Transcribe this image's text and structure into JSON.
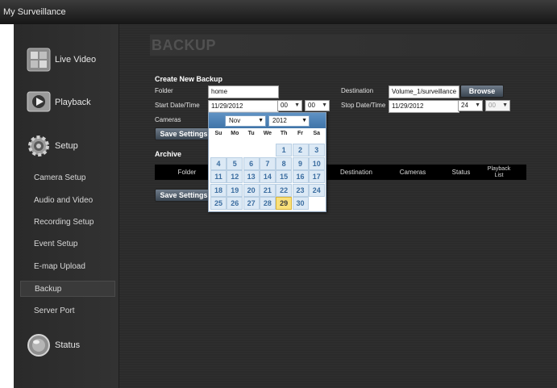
{
  "window": {
    "title": "My Surveillance"
  },
  "sidebar": {
    "main_items": [
      {
        "label": "Live Video",
        "icon": "live-video-icon"
      },
      {
        "label": "Playback",
        "icon": "playback-icon"
      },
      {
        "label": "Setup",
        "icon": "gear-icon"
      },
      {
        "label": "Status",
        "icon": "status-icon"
      }
    ],
    "setup_items": [
      {
        "label": "Camera Setup"
      },
      {
        "label": "Audio and Video"
      },
      {
        "label": "Recording Setup"
      },
      {
        "label": "Event Setup"
      },
      {
        "label": "E-map Upload"
      },
      {
        "label": "Backup",
        "active": true
      },
      {
        "label": "Server Port"
      }
    ]
  },
  "page": {
    "title": "BACKUP",
    "create_heading": "Create New Backup",
    "folder_label": "Folder",
    "folder_value": "home",
    "destination_label": "Destination",
    "destination_value": "Volume_1/surveillance",
    "browse_label": "Browse",
    "start_label": "Start Date/Time",
    "start_date": "11/29/2012",
    "start_hour": "00",
    "start_min": "00",
    "stop_label": "Stop Date/Time",
    "stop_date": "11/29/2012",
    "stop_hour": "24",
    "stop_min": "00",
    "cameras_label": "Cameras",
    "save_label": "Save Settings",
    "archive_heading": "Archive",
    "table_columns": [
      "Folder",
      "Destination",
      "Cameras",
      "Status",
      "Playback List"
    ],
    "save2_label": "Save Settings"
  },
  "calendar": {
    "month": "Nov",
    "year": "2012",
    "day_headers": [
      "Su",
      "Mo",
      "Tu",
      "We",
      "Th",
      "Fr",
      "Sa"
    ],
    "weeks": [
      [
        "",
        "",
        "",
        "",
        "1",
        "2",
        "3"
      ],
      [
        "4",
        "5",
        "6",
        "7",
        "8",
        "9",
        "10"
      ],
      [
        "11",
        "12",
        "13",
        "14",
        "15",
        "16",
        "17"
      ],
      [
        "18",
        "19",
        "20",
        "21",
        "22",
        "23",
        "24"
      ],
      [
        "25",
        "26",
        "27",
        "28",
        "29",
        "30",
        ""
      ]
    ],
    "today": "29"
  },
  "colors": {
    "accent": "#3f74a8",
    "today": "#f9e07a",
    "sidebar_bg": "#2a2a2a"
  }
}
